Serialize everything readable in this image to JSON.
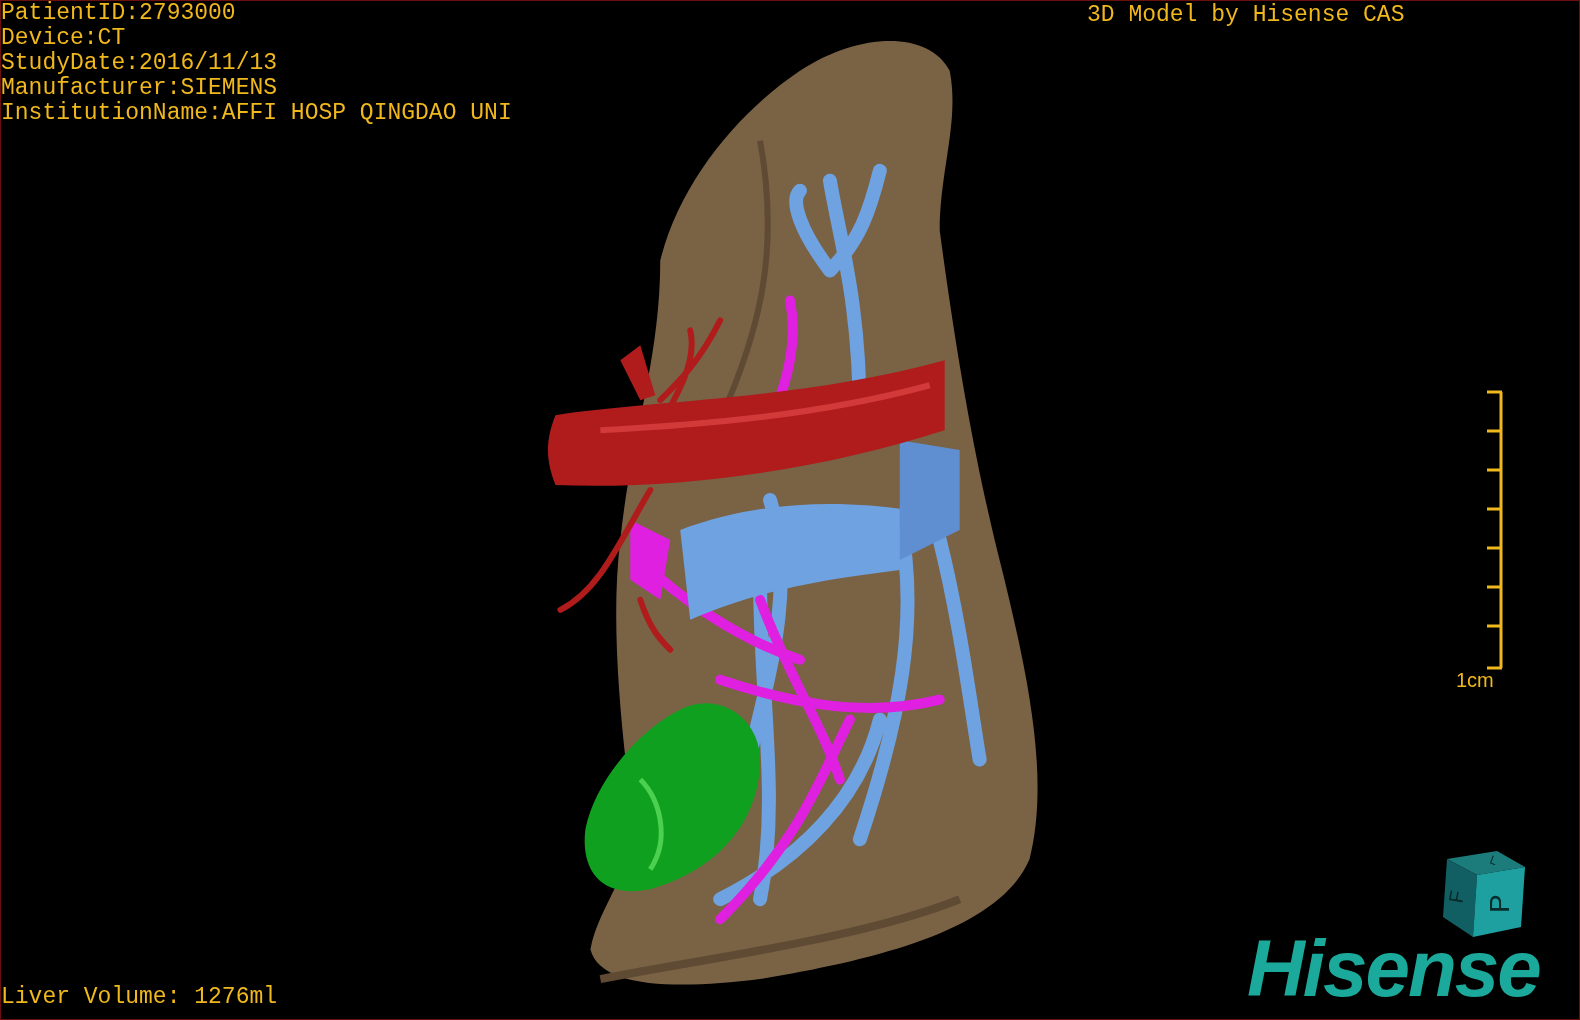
{
  "patient_info": [
    "PatientID:2793000",
    "Device:CT",
    "StudyDate:2016/11/13",
    "Manufacturer:SIEMENS",
    "InstitutionName:AFFI HOSP QINGDAO UNI"
  ],
  "model_credit": "3D Model by Hisense CAS",
  "scale_bar": {
    "label": "1cm"
  },
  "orientation_cube": {
    "front": "P",
    "side": "F",
    "top": "L"
  },
  "liver_volume": "Liver Volume: 1276ml",
  "logo": "Hisense"
}
